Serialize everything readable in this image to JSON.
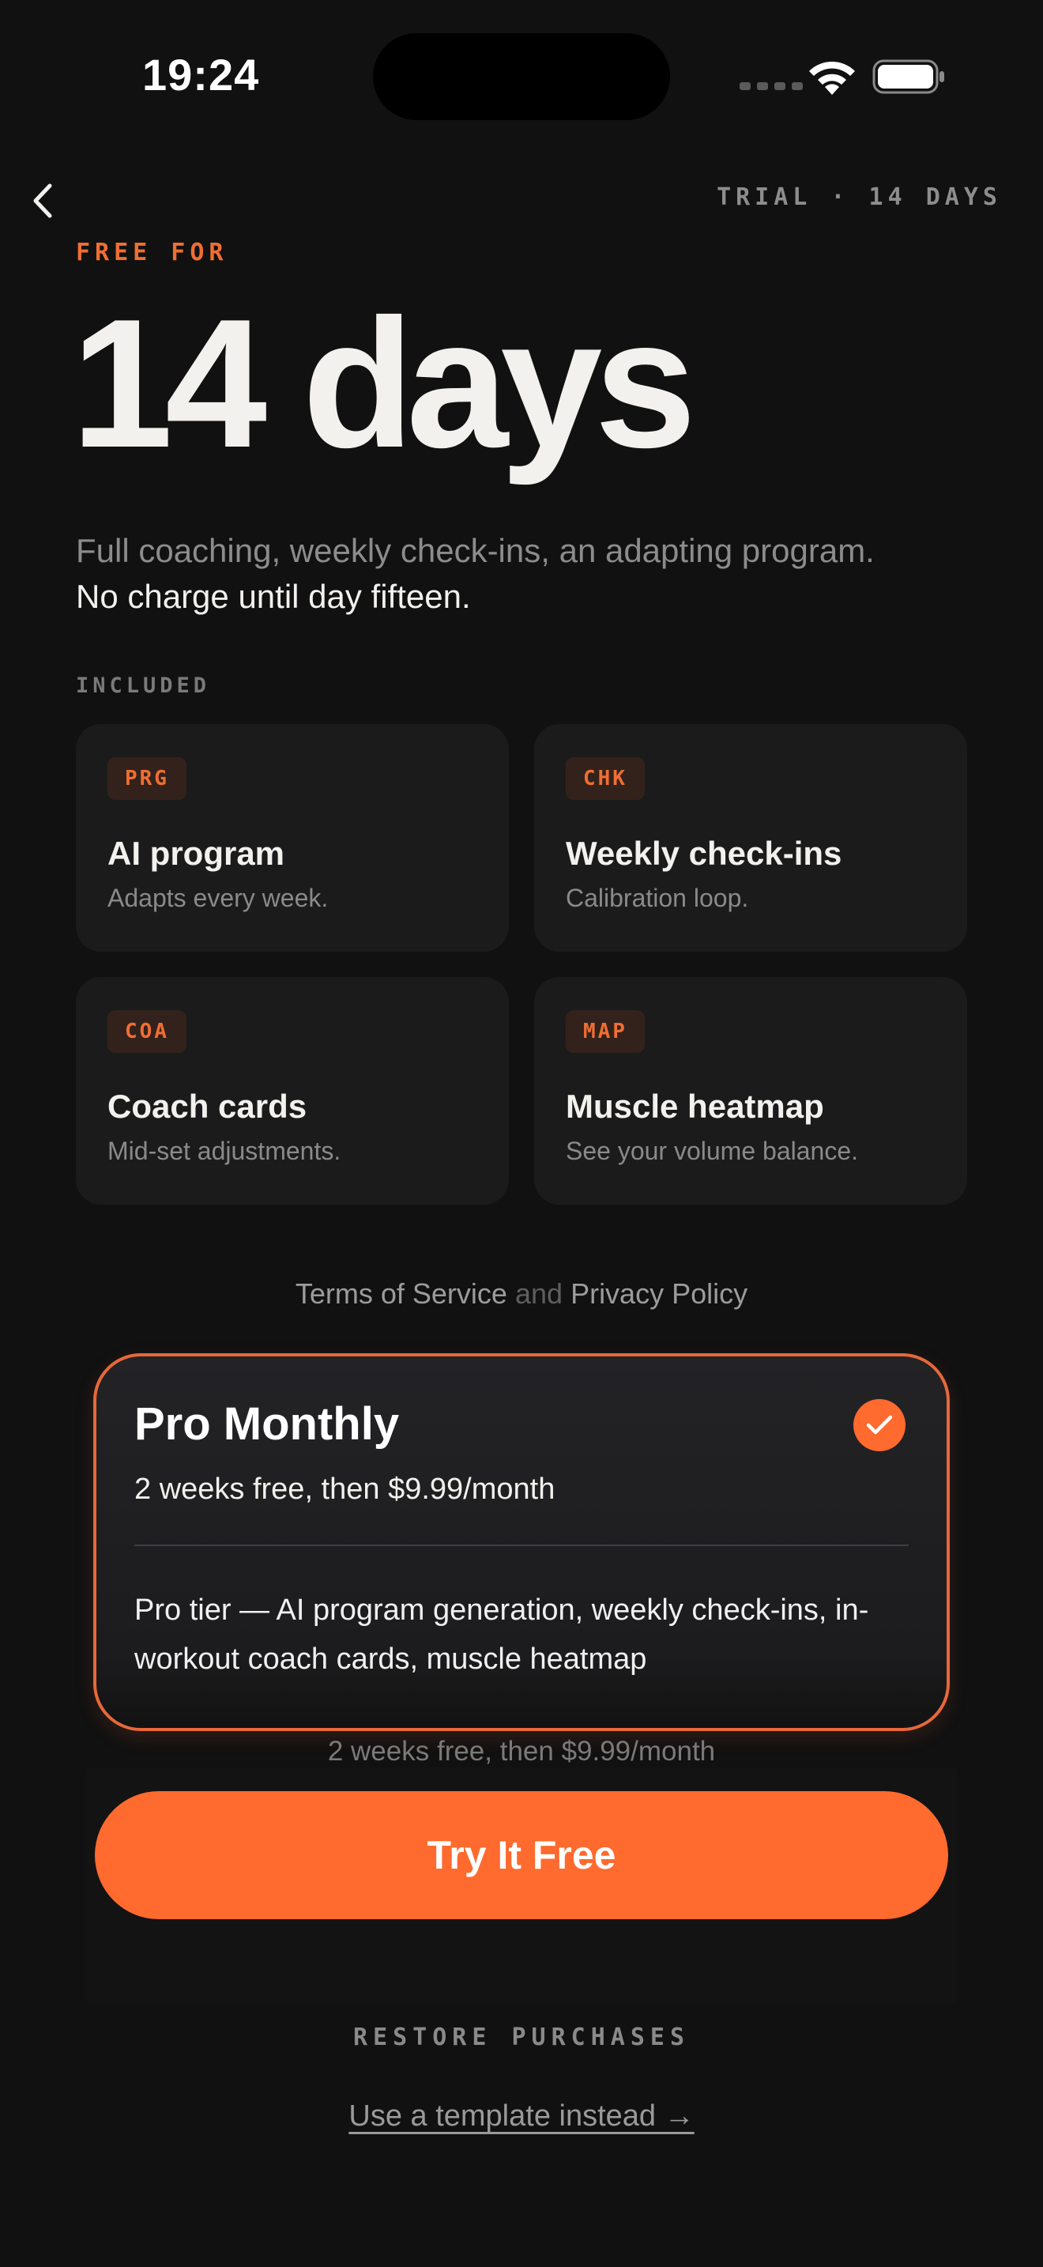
{
  "status_bar": {
    "time": "19:24"
  },
  "nav": {
    "trial_tag": "TRIAL · 14 DAYS"
  },
  "hero": {
    "eyebrow": "FREE FOR",
    "headline": "14 days",
    "lede_muted": "Full coaching, weekly check-ins, an adapting program.",
    "lede_emphasis": "No charge until day fifteen."
  },
  "included": {
    "label": "INCLUDED",
    "items": [
      {
        "code": "PRG",
        "title": "AI program",
        "subtitle": "Adapts every week."
      },
      {
        "code": "CHK",
        "title": "Weekly check-ins",
        "subtitle": "Calibration loop."
      },
      {
        "code": "COA",
        "title": "Coach cards",
        "subtitle": "Mid-set adjustments."
      },
      {
        "code": "MAP",
        "title": "Muscle heatmap",
        "subtitle": "See your volume balance."
      }
    ]
  },
  "legal": {
    "terms": "Terms of Service",
    "and": "and",
    "privacy": "Privacy Policy"
  },
  "plan": {
    "title": "Pro Monthly",
    "price": "2 weeks free, then $9.99/month",
    "description": "Pro tier — AI program generation, weekly check-ins, in-workout coach cards, muscle heatmap",
    "selected": true
  },
  "footer": {
    "price_note": "2 weeks free, then $9.99/month",
    "cta": "Try It Free",
    "restore": "RESTORE PURCHASES",
    "template_link": "Use a template instead →"
  },
  "colors": {
    "accent": "#ff6a2e",
    "background": "#111111",
    "card": "#1b1b1b"
  }
}
